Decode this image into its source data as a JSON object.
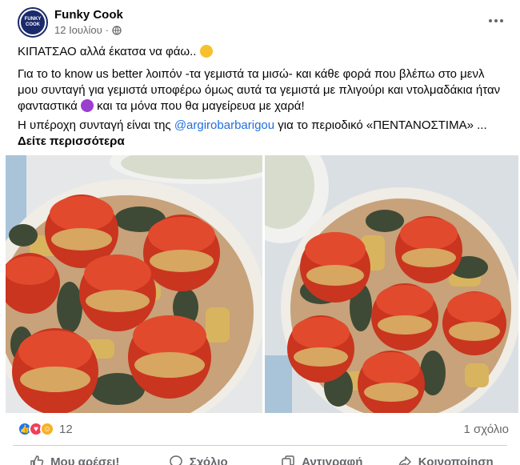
{
  "post": {
    "author": "Funky Cook",
    "avatar_text": "FUNKY COOK",
    "date": "12 Ιουλίου",
    "privacy_icon": "globe-icon",
    "text_line1": "ΚΙΠΑΤΣΑΟ αλλά έκατσα να φάω.. ",
    "text_para2": "Για το to know us better λοιπόν -τα γεμιστά τα μισώ- και κάθε φορά που βλέπω στο μενλ μου συνταγή για γεμιστά υποφέρω όμως αυτά τα γεμιστά με πλιγούρι και ντολμαδάκια ήταν φανταστικά ",
    "text_para2_end": " και τα μόνα που θα μαγείρευα με χαρά!",
    "text_para3_start": "Η υπέροχη συνταγή είναι της ",
    "mention": "@argirobarbarigou",
    "text_para3_end": " για το περιοδικό «ΠΕΝΤΑΝΟΣΤΙΜΑ» ... ",
    "see_more": "Δείτε περισσότερα"
  },
  "stats": {
    "reaction_icons": [
      "like-icon",
      "love-icon",
      "care-icon"
    ],
    "reaction_count": "12",
    "comments": "1 σχόλιο"
  },
  "actions": {
    "like": "Μου αρέσει!",
    "comment": "Σχόλιο",
    "copy": "Αντιγραφή",
    "share": "Κοινοποίηση"
  },
  "colors": {
    "link": "#216fdb",
    "muted": "#65676b",
    "like": "#1877f2",
    "love": "#f33e58",
    "care": "#f7b125",
    "tomato": "#d9412b",
    "leaf": "#3e4a35"
  }
}
